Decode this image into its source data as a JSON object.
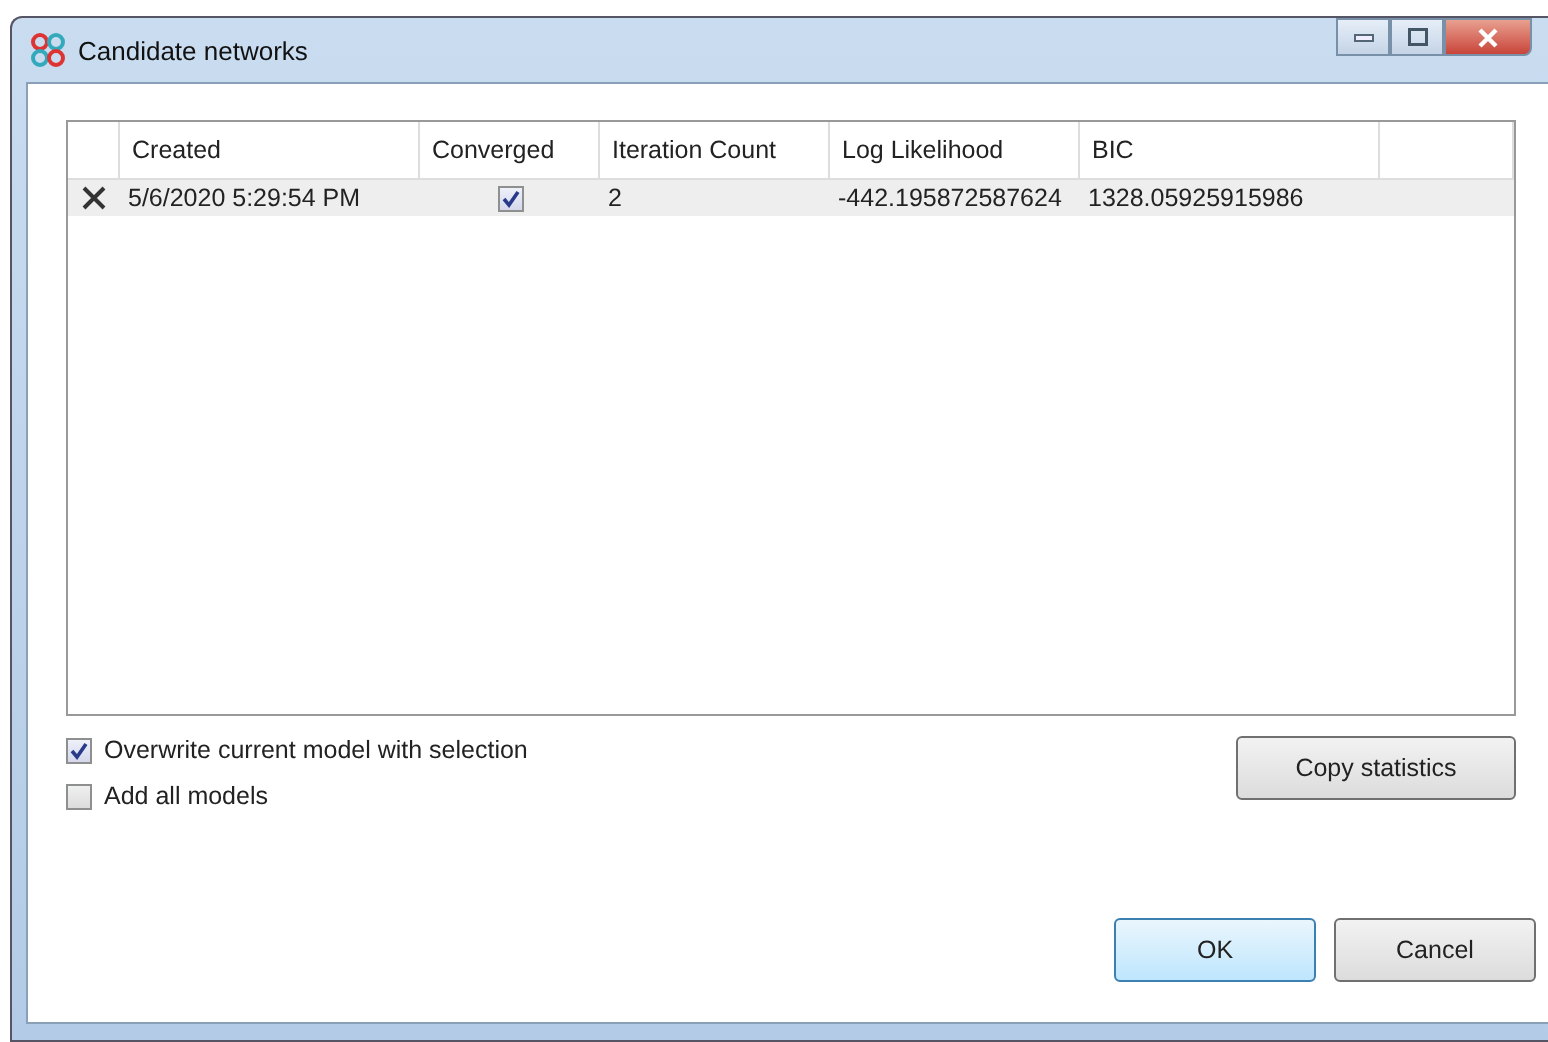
{
  "window": {
    "title": "Candidate networks"
  },
  "table": {
    "columns": [
      "Created",
      "Converged",
      "Iteration Count",
      "Log Likelihood",
      "BIC"
    ],
    "rows": [
      {
        "created": "5/6/2020 5:29:54 PM",
        "converged": true,
        "iteration_count": "2",
        "log_likelihood": "-442.195872587624",
        "bic": "1328.05925915986",
        "selected": true
      }
    ]
  },
  "options": [
    {
      "label": "Overwrite current model with selection",
      "checked": true
    },
    {
      "label": "Add all models",
      "checked": false
    }
  ],
  "copy_button": "Copy statistics",
  "buttons": [
    {
      "label": "OK",
      "kind": "default"
    },
    {
      "label": "Cancel",
      "kind": "normal"
    }
  ]
}
